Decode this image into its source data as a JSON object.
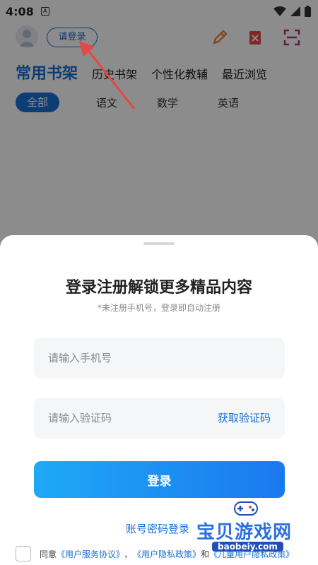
{
  "status": {
    "time": "4:08",
    "note": "A"
  },
  "header": {
    "login_label": "请登录"
  },
  "tabs": [
    "常用书架",
    "历史书架",
    "个性化教辅",
    "最近浏览"
  ],
  "subtabs": [
    "全部",
    "语文",
    "数学",
    "英语"
  ],
  "sheet": {
    "title": "登录注册解锁更多精品内容",
    "subtitle": "*未注册手机号，登录即自动注册",
    "phone_placeholder": "请输入手机号",
    "code_placeholder": "请输入验证码",
    "get_code": "获取验证码",
    "login_button": "登录",
    "password_login": "账号密码登录",
    "agree_prefix": "同意",
    "agree_link1": "《用户服务协议》",
    "agree_sep": "、",
    "agree_link2": "《用户隐私政策》",
    "agree_and": "和",
    "agree_link3": "《儿童用户隐私政策》"
  },
  "watermark": {
    "name": "宝贝游戏网",
    "url": "baobeiy.com"
  },
  "colors": {
    "accent": "#1a6fd6",
    "arrow": "#e54848"
  }
}
